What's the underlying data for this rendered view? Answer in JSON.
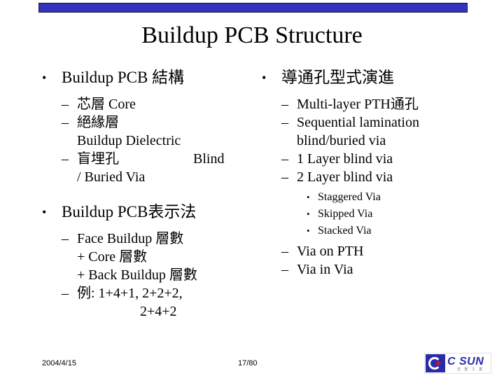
{
  "slide": {
    "title": "Buildup PCB Structure",
    "accent_color": "#3333BB",
    "accent_border_color": "#151550"
  },
  "left_column": {
    "heading1": "Buildup PCB 結構",
    "items1": [
      {
        "text": "芯層 Core"
      },
      {
        "text": "絕緣層",
        "continuation": "Buildup Dielectric"
      },
      {
        "text": "盲埋孔",
        "trailing": "Blind",
        "continuation": "/ Buried Via"
      }
    ],
    "heading2": "Buildup PCB表示法",
    "items2": [
      {
        "text": "Face Buildup 層數",
        "continuation": "+ Core 層數",
        "continuation2": "+ Back Buildup 層數"
      },
      {
        "text": "例: 1+4+1, 2+2+2,",
        "continuation": "2+4+2"
      }
    ]
  },
  "right_column": {
    "heading1": "導通孔型式演進",
    "items": [
      {
        "text": "Multi-layer PTH通孔"
      },
      {
        "text": "Sequential lamination",
        "continuation": "blind/buried via"
      },
      {
        "text": "1 Layer blind via"
      },
      {
        "text": "2 Layer blind via"
      }
    ],
    "sub_items": [
      {
        "text": "Staggered Via"
      },
      {
        "text": "Skipped Via"
      },
      {
        "text": "Stacked Via"
      }
    ],
    "items_tail": [
      {
        "text": "Via on PTH"
      },
      {
        "text": "Via in Via"
      }
    ]
  },
  "footer": {
    "date": "2004/4/15",
    "page": "17/80"
  },
  "logo": {
    "wordmark": "C SUN",
    "subtext": "志 聖 工 業",
    "mark_color": "#2B2BA8",
    "dot_color": "#D81020"
  },
  "glyphs": {
    "bullet_round": "•",
    "dash": "–"
  }
}
